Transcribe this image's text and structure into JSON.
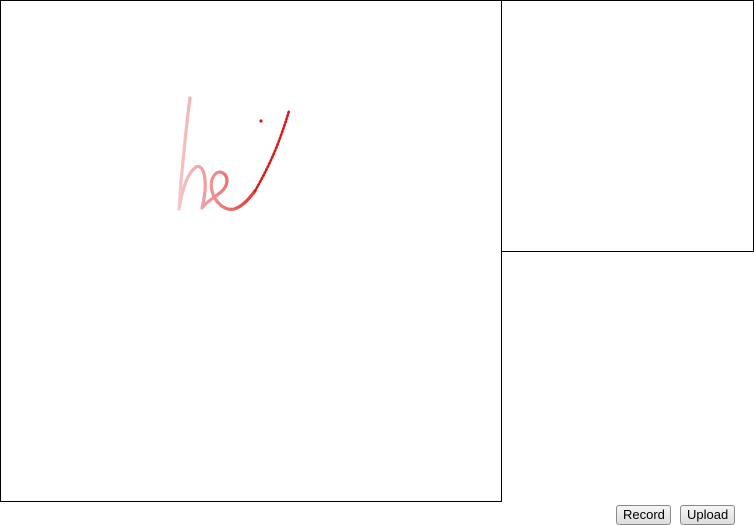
{
  "controls": {
    "record_label": "Record",
    "upload_label": "Upload"
  },
  "colors": {
    "stroke_start": "#f5c4c4",
    "stroke_mid": "#ee7070",
    "stroke_end": "#e02020",
    "border": "#000000"
  }
}
